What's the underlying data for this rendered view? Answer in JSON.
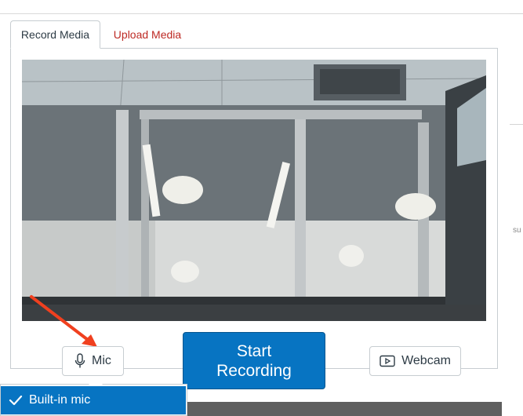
{
  "tabs": [
    {
      "label": "Record Media",
      "active": true
    },
    {
      "label": "Upload Media",
      "active": false
    }
  ],
  "controls": {
    "mic_label": "Mic",
    "start_label": "Start\nRecording",
    "webcam_label": "Webcam"
  },
  "mic_menu": {
    "selected": "Built-in mic"
  },
  "background": {
    "partial_text": "su"
  },
  "colors": {
    "accent": "#0774c2",
    "link": "#bd2a24",
    "annotation_arrow": "#f0401f"
  },
  "icons": {
    "mic": "microphone-icon",
    "webcam": "video-play-icon",
    "check": "checkmark-icon"
  }
}
